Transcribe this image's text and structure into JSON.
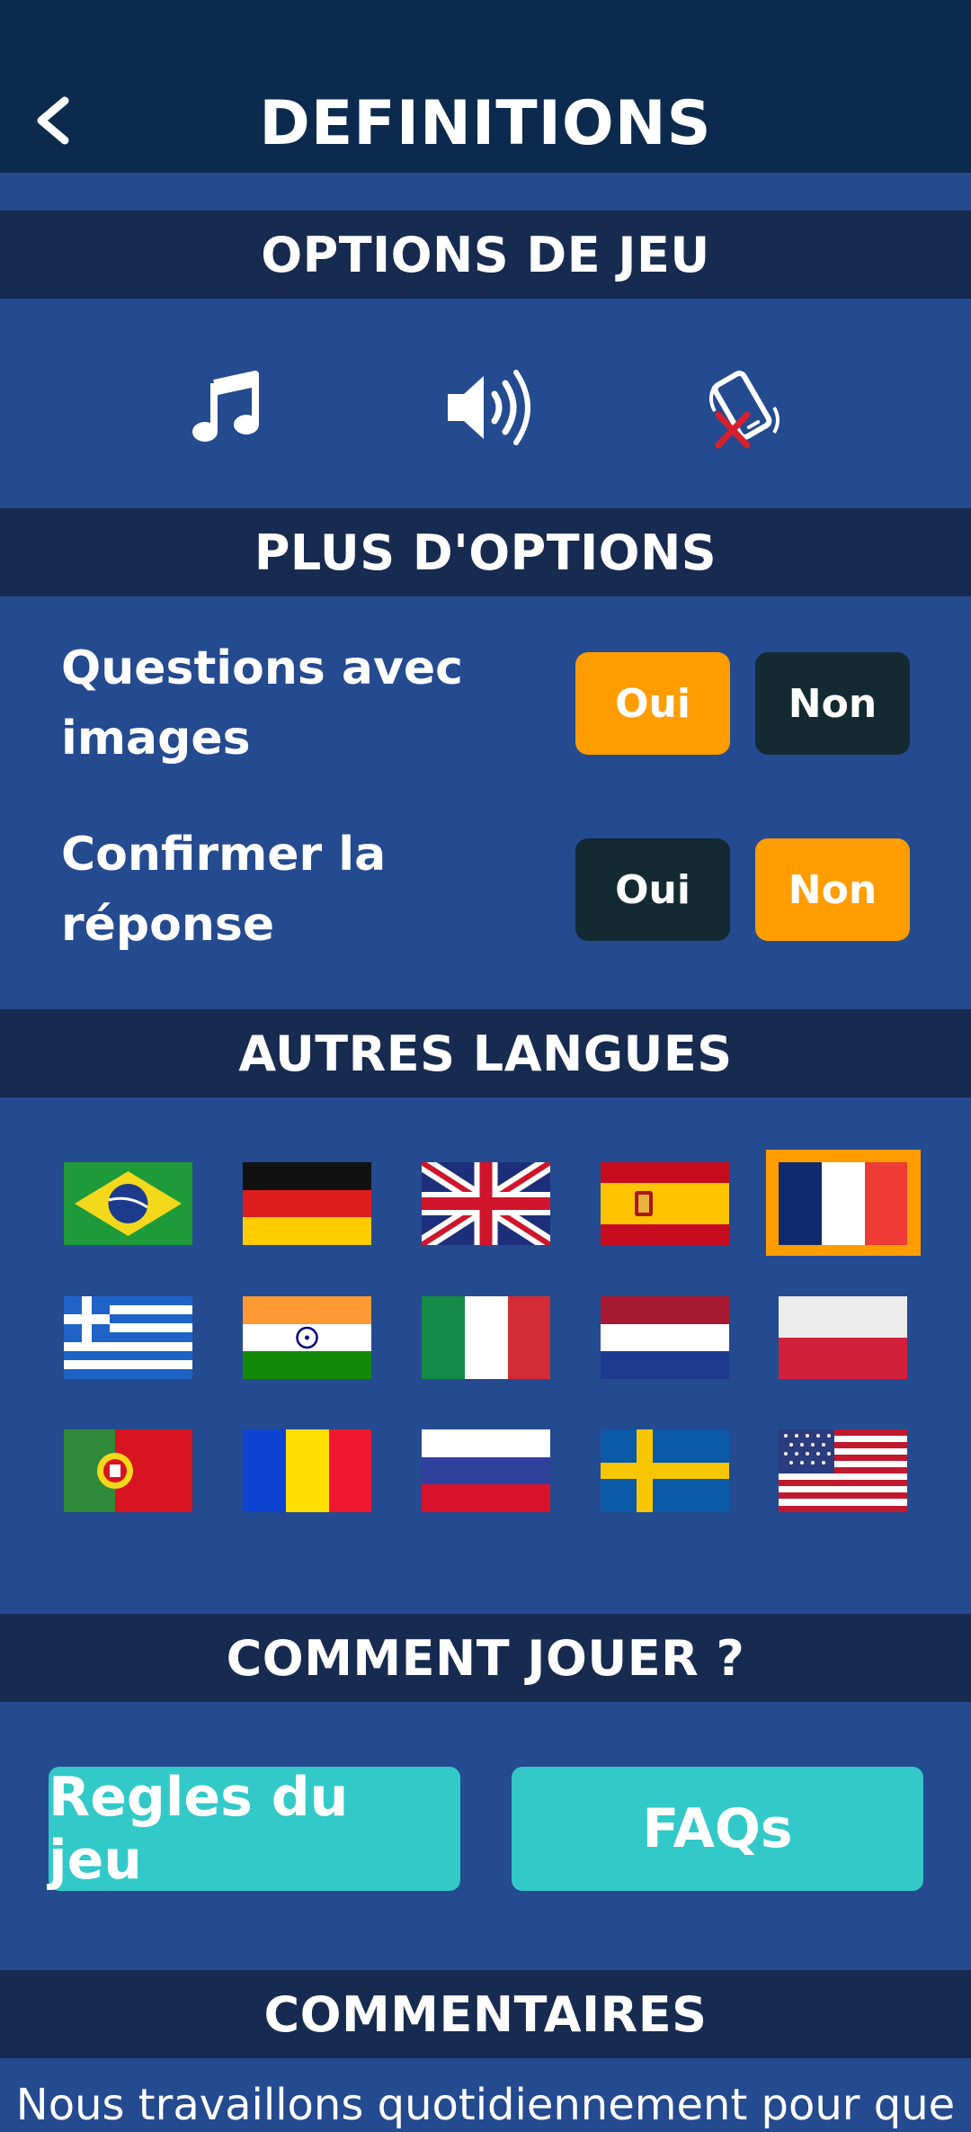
{
  "header": {
    "title": "DEFINITIONS",
    "back_icon": "chevron-left-icon"
  },
  "game_options": {
    "title": "OPTIONS DE JEU",
    "icons": [
      "music-note-icon",
      "speaker-volume-icon",
      "vibration-off-icon"
    ]
  },
  "more_options": {
    "title": "PLUS D'OPTIONS",
    "rows": [
      {
        "label_line1": "Questions avec",
        "label_line2": "images",
        "yes": "Oui",
        "no": "Non",
        "selected": "Oui"
      },
      {
        "label_line1": "Confirmer la",
        "label_line2": "réponse",
        "yes": "Oui",
        "no": "Non",
        "selected": "Non"
      }
    ]
  },
  "languages": {
    "title": "AUTRES LANGUES",
    "flags": [
      "brazil",
      "germany",
      "united-kingdom",
      "spain",
      "france",
      "greece",
      "india",
      "italy",
      "netherlands",
      "poland",
      "portugal",
      "romania",
      "russia",
      "sweden",
      "united-states"
    ],
    "selected": "france"
  },
  "how_to_play": {
    "title": "COMMENT JOUER ?",
    "rules_button": "Regles du jeu",
    "faq_button": "FAQs"
  },
  "comments": {
    "title": "COMMENTAIRES",
    "text": "Nous travaillons quotidiennement pour que"
  },
  "colors": {
    "background": "#244a8f",
    "band": "#172a50",
    "topbar": "#0c2a4d",
    "accent_orange": "#ff9d00",
    "dark_button": "#142a33",
    "teal_button": "#33c9c9"
  }
}
